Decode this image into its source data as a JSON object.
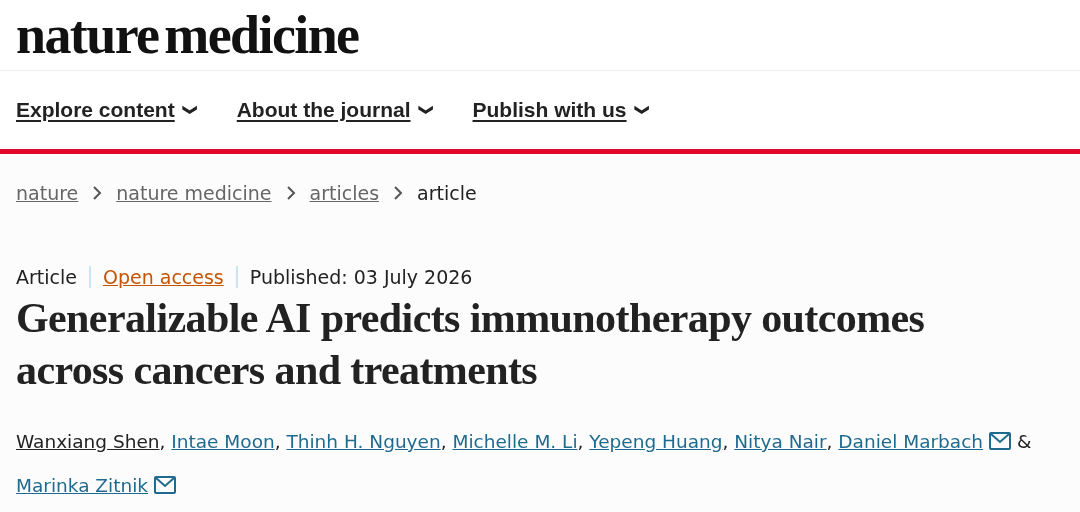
{
  "logo": "nature medicine",
  "nav": [
    {
      "label": "Explore content",
      "caret": "❯"
    },
    {
      "label": "About the journal",
      "caret": "❯"
    },
    {
      "label": "Publish with us",
      "caret": "❯"
    }
  ],
  "breadcrumb": [
    {
      "label": "nature",
      "current": false
    },
    {
      "label": "nature medicine",
      "current": false
    },
    {
      "label": "articles",
      "current": false
    },
    {
      "label": "article",
      "current": true
    }
  ],
  "meta": [
    {
      "kind": "type",
      "text": "Article"
    },
    {
      "kind": "access",
      "text": "Open access"
    },
    {
      "kind": "date",
      "text": "Published: 03 July 2026"
    }
  ],
  "title": "Generalizable AI predicts immunotherapy outcomes across cancers and treatments",
  "authors": [
    {
      "name": "Wanxiang Shen",
      "highlighted": true,
      "separator": ","
    },
    {
      "name": "Intae Moon",
      "highlighted": false,
      "separator": ","
    },
    {
      "name": "Thinh H. Nguyen",
      "highlighted": false,
      "separator": ","
    },
    {
      "name": "Michelle M. Li",
      "highlighted": false,
      "separator": ","
    },
    {
      "name": "Yepeng Huang",
      "highlighted": false,
      "separator": ","
    },
    {
      "name": "Nitya Nair",
      "highlighted": false,
      "separator": ","
    },
    {
      "name": "Daniel Marbach",
      "highlighted": false,
      "email": true,
      "separator": "&"
    },
    {
      "name": "Marinka Zitnik",
      "highlighted": false,
      "email": true
    }
  ]
}
